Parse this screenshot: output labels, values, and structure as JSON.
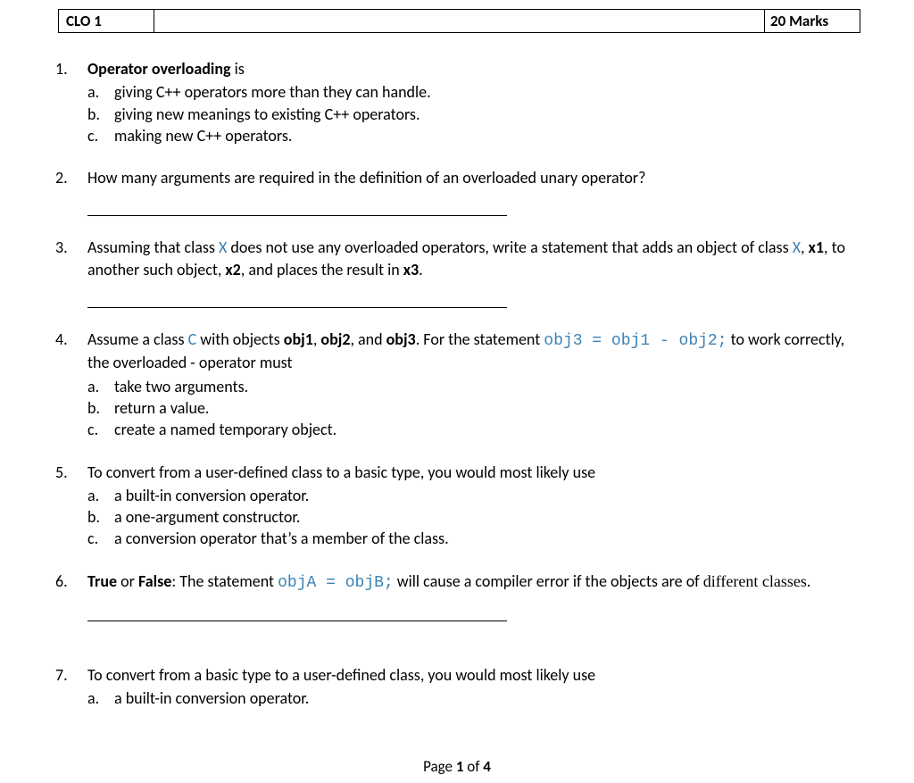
{
  "header": {
    "left": "CLO 1",
    "right": "20  Marks"
  },
  "questions": [
    {
      "stem_parts": [
        {
          "t": "Operator overloading",
          "b": true
        },
        {
          "t": " is"
        }
      ],
      "options": [
        "giving C++ operators more than they can handle.",
        "giving new meanings to existing C++ operators.",
        "making new C++ operators."
      ]
    },
    {
      "stem_parts": [
        {
          "t": "How many arguments are required in the definition of an overloaded unary operator?"
        }
      ],
      "blank": true
    },
    {
      "stem_parts": [
        {
          "t": "Assuming that class "
        },
        {
          "t": "X",
          "cls": true
        },
        {
          "t": " does not use any overloaded operators, write a statement that adds an object of class "
        },
        {
          "t": "X",
          "cls": true
        },
        {
          "t": ", "
        },
        {
          "t": "x1",
          "b": true
        },
        {
          "t": ", to another such object, "
        },
        {
          "t": "x2",
          "b": true
        },
        {
          "t": ", and places the result in "
        },
        {
          "t": "x3",
          "b": true
        },
        {
          "t": "."
        }
      ],
      "blank": true
    },
    {
      "stem_parts": [
        {
          "t": "Assume a class "
        },
        {
          "t": "C",
          "cls": true
        },
        {
          "t": " with objects "
        },
        {
          "t": "obj1",
          "b": true
        },
        {
          "t": ", "
        },
        {
          "t": "obj2",
          "b": true
        },
        {
          "t": ", and "
        },
        {
          "t": "obj3",
          "b": true
        },
        {
          "t": ". For the statement "
        },
        {
          "t": "obj3 = obj1 - obj2;",
          "code": true
        },
        {
          "t": " to work correctly, the overloaded - operator must"
        }
      ],
      "options": [
        "take two arguments.",
        "return a value.",
        "create a named temporary object."
      ]
    },
    {
      "stem_parts": [
        {
          "t": "To convert from a user-defined class to a basic type, you would most likely use"
        }
      ],
      "options": [
        "a built-in conversion operator.",
        "a one-argument constructor.",
        "a conversion operator that’s a member of the class."
      ]
    },
    {
      "stem_parts": [
        {
          "t": "True",
          "b": true
        },
        {
          "t": " or "
        },
        {
          "t": "False",
          "b": true
        },
        {
          "t": ": The statement "
        },
        {
          "t": "objA = objB;",
          "code": true
        },
        {
          "t": " will cause a compiler error if the objects are of "
        },
        {
          "t": "different classes",
          "ser": true
        },
        {
          "t": "."
        }
      ],
      "blank": true,
      "extra_gap": true
    },
    {
      "stem_parts": [
        {
          "t": "To convert from a basic type to a user-defined class, you would most likely use"
        }
      ],
      "options": [
        "a built-in conversion operator."
      ]
    }
  ],
  "footer": {
    "prefix": "Page ",
    "current": "1",
    "middle": " of ",
    "total": "4"
  }
}
